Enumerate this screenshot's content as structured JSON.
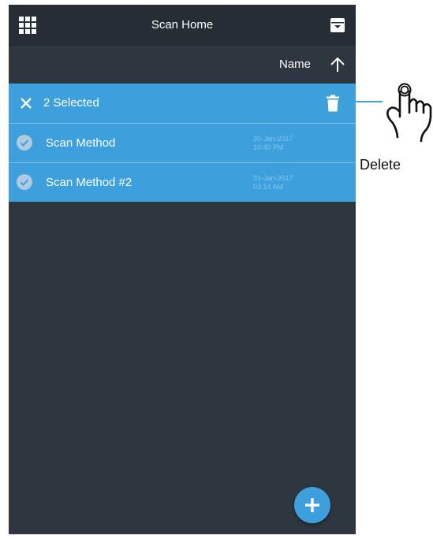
{
  "header": {
    "title": "Scan Home"
  },
  "sort": {
    "label": "Name",
    "direction": "ascending"
  },
  "selection": {
    "count_label": "2 Selected"
  },
  "rows": [
    {
      "name": "Scan Method",
      "date": "30-Jan-2017",
      "time": "10:40 PM"
    },
    {
      "name": "Scan Method #2",
      "date": "31-Jan-2017",
      "time": "03:14 AM"
    }
  ],
  "callout": {
    "label": "Delete"
  },
  "colors": {
    "accent": "#3d9fdb",
    "background": "#2e3740",
    "topbar": "#262d34"
  },
  "icons": {
    "menu": "grid-icon",
    "archive": "archive-icon",
    "sort": "arrow-up-icon",
    "close": "close-icon",
    "delete": "trash-icon",
    "selected": "check-circle-icon",
    "add": "plus-icon",
    "pointer": "hand-pointer-icon"
  }
}
